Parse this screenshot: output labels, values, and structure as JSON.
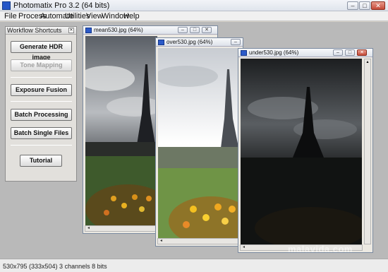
{
  "app": {
    "title": "Photomatix Pro 3.2 (64 bits)"
  },
  "menu": [
    "File",
    "Process",
    "Automate",
    "Utilities",
    "View",
    "Window",
    "Help"
  ],
  "workflow": {
    "title": "Workflow Shortcuts",
    "buttons": {
      "generate_hdr": "Generate HDR image",
      "tone_mapping": "Tone Mapping",
      "exposure_fusion": "Exposure Fusion",
      "batch_processing": "Batch Processing",
      "batch_single": "Batch Single Files",
      "tutorial": "Tutorial"
    },
    "tone_mapping_enabled": false
  },
  "windows": [
    {
      "title": "mean530.jpg (64%)",
      "exposure": "mean"
    },
    {
      "title": "over530.jpg (64%)",
      "exposure": "over"
    },
    {
      "title": "under530.jpg (64%)",
      "exposure": "under"
    }
  ],
  "status": {
    "text": "530x795 (333x504) 3 channels 8 bits"
  },
  "watermark": "malavida.com"
}
